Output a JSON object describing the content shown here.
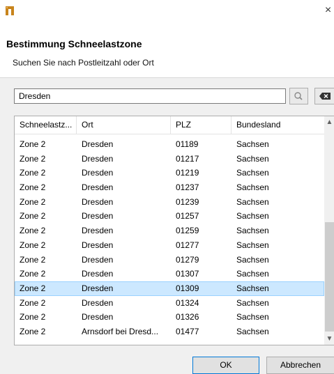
{
  "window": {
    "close_glyph": "×"
  },
  "header": {
    "title": "Bestimmung Schneelastzone",
    "subtitle": "Suchen Sie nach Postleitzahl oder Ort"
  },
  "search": {
    "value": "Dresden",
    "search_icon": "magnifier-icon",
    "clear_icon": "backspace-clear-icon"
  },
  "table": {
    "columns": [
      "Schneelastz...",
      "Ort",
      "PLZ",
      "Bundesland"
    ],
    "selected_index": 10,
    "rows": [
      {
        "zone": "Zone 2",
        "ort": "Dresden",
        "plz": "01189",
        "land": "Sachsen"
      },
      {
        "zone": "Zone 2",
        "ort": "Dresden",
        "plz": "01217",
        "land": "Sachsen"
      },
      {
        "zone": "Zone 2",
        "ort": "Dresden",
        "plz": "01219",
        "land": "Sachsen"
      },
      {
        "zone": "Zone 2",
        "ort": "Dresden",
        "plz": "01237",
        "land": "Sachsen"
      },
      {
        "zone": "Zone 2",
        "ort": "Dresden",
        "plz": "01239",
        "land": "Sachsen"
      },
      {
        "zone": "Zone 2",
        "ort": "Dresden",
        "plz": "01257",
        "land": "Sachsen"
      },
      {
        "zone": "Zone 2",
        "ort": "Dresden",
        "plz": "01259",
        "land": "Sachsen"
      },
      {
        "zone": "Zone 2",
        "ort": "Dresden",
        "plz": "01277",
        "land": "Sachsen"
      },
      {
        "zone": "Zone 2",
        "ort": "Dresden",
        "plz": "01279",
        "land": "Sachsen"
      },
      {
        "zone": "Zone 2",
        "ort": "Dresden",
        "plz": "01307",
        "land": "Sachsen"
      },
      {
        "zone": "Zone 2",
        "ort": "Dresden",
        "plz": "01309",
        "land": "Sachsen"
      },
      {
        "zone": "Zone 2",
        "ort": "Dresden",
        "plz": "01324",
        "land": "Sachsen"
      },
      {
        "zone": "Zone 2",
        "ort": "Dresden",
        "plz": "01326",
        "land": "Sachsen"
      },
      {
        "zone": "Zone 2",
        "ort": "Arnsdorf bei Dresd...",
        "plz": "01477",
        "land": "Sachsen"
      }
    ]
  },
  "buttons": {
    "ok": "OK",
    "cancel": "Abbrechen"
  },
  "colors": {
    "brand": "#c8841c",
    "selection": "#cce8ff",
    "focus": "#0078d7"
  }
}
